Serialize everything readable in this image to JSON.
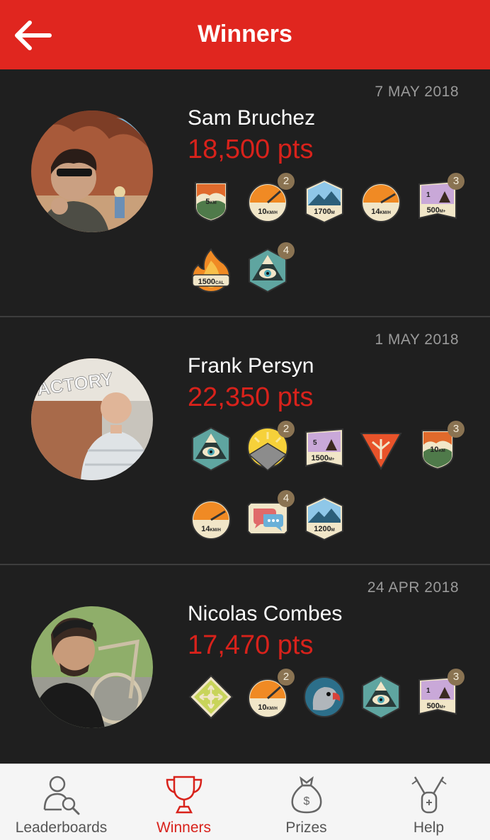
{
  "header": {
    "title": "Winners"
  },
  "winners": [
    {
      "date": "7 MAY 2018",
      "name": "Sam Bruchez",
      "points": "18,500 pts",
      "badges": [
        {
          "icon": "5km-badge-icon",
          "text": "5",
          "unit": "KM"
        },
        {
          "icon": "speed-10kmh-badge-icon",
          "text": "10",
          "unit": "KM/H",
          "count": "2"
        },
        {
          "icon": "elevation-1700m-badge-icon",
          "text": "1700",
          "unit": "M"
        },
        {
          "icon": "speed-14kmh-badge-icon",
          "text": "14",
          "unit": "KM/H"
        },
        {
          "icon": "climb-500m-badge-icon",
          "text": "1",
          "text2": "500",
          "unit": "M+",
          "count": "3"
        },
        {
          "icon": "burn-1500cal-badge-icon",
          "text": "1500",
          "unit": "CAL"
        },
        {
          "icon": "mountain-eye-badge-icon",
          "count": "4"
        }
      ]
    },
    {
      "date": "1 MAY 2018",
      "name": "Frank Persyn",
      "points": "22,350 pts",
      "badges": [
        {
          "icon": "mountain-eye-badge-icon"
        },
        {
          "icon": "sunrise-badge-icon",
          "count": "2"
        },
        {
          "icon": "climb-1500m-badge-icon",
          "text": "5",
          "text2": "1500",
          "unit": "M+"
        },
        {
          "icon": "triangle-shield-badge-icon"
        },
        {
          "icon": "10km-badge-icon",
          "text": "10",
          "unit": "KM",
          "count": "3"
        },
        {
          "icon": "speed-14kmh-badge-icon",
          "text": "14",
          "unit": "KM/H"
        },
        {
          "icon": "chat-badge-icon",
          "count": "4"
        },
        {
          "icon": "elevation-1200m-badge-icon",
          "text": "1200",
          "unit": "M"
        }
      ]
    },
    {
      "date": "24 APR 2018",
      "name": "Nicolas Combes",
      "points": "17,470 pts",
      "badges": [
        {
          "icon": "compass-badge-icon"
        },
        {
          "icon": "speed-10kmh-badge-icon",
          "text": "10",
          "unit": "KM/H",
          "count": "2"
        },
        {
          "icon": "parrot-badge-icon"
        },
        {
          "icon": "mountain-eye-badge-icon"
        },
        {
          "icon": "climb-500m-badge-icon",
          "text": "1",
          "text2": "500",
          "unit": "M+",
          "count": "3"
        }
      ]
    }
  ],
  "tabs": [
    {
      "label": "Leaderboards",
      "icon": "leaderboards-icon"
    },
    {
      "label": "Winners",
      "icon": "trophy-icon",
      "active": true
    },
    {
      "label": "Prizes",
      "icon": "money-bag-icon"
    },
    {
      "label": "Help",
      "icon": "swiss-knife-icon"
    }
  ],
  "colors": {
    "accent": "#e0261f",
    "background": "#1f1f1f",
    "badge_count": "#8a7352"
  }
}
